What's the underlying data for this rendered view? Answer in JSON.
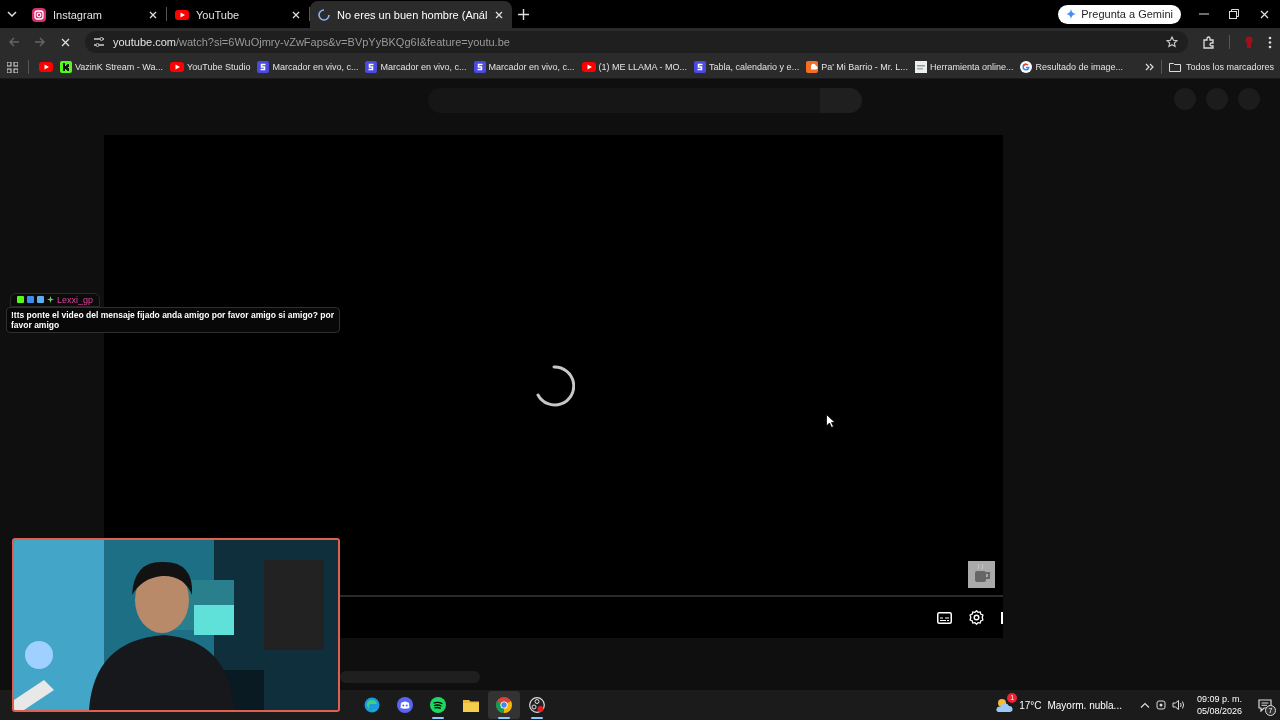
{
  "tabs": [
    {
      "title": "Instagram",
      "kind": "instagram",
      "selected": false
    },
    {
      "title": "YouTube",
      "kind": "youtube",
      "selected": false
    },
    {
      "title": "No eres un buen hombre (Anál",
      "kind": "loading",
      "selected": true
    }
  ],
  "gemini_button": "Pregunta a Gemini",
  "address": {
    "host": "youtube.com",
    "path": "/watch?si=6WuOjmry-vZwFaps&v=BVpYyBKQg6I&feature=youtu.be"
  },
  "bookmarks": [
    {
      "kind": "youtube"
    },
    {
      "label": "VazinK Stream - Wa...",
      "kind": "kick"
    },
    {
      "label": "YouTube Studio",
      "kind": "youtube"
    },
    {
      "label": "Marcador en vivo, c...",
      "kind": "scoreboard"
    },
    {
      "label": "Marcador en vivo, c...",
      "kind": "scoreboard"
    },
    {
      "label": "Marcador en vivo, c...",
      "kind": "scoreboard"
    },
    {
      "label": "(1) ME LLAMA - MO...",
      "kind": "youtube"
    },
    {
      "label": "Tabla, calendario y e...",
      "kind": "scoreboard"
    },
    {
      "label": "Pa' Mi Barrio - Mr. L...",
      "kind": "soundcloud"
    },
    {
      "label": "Herramienta online...",
      "kind": "page"
    },
    {
      "label": "Resultado de image...",
      "kind": "google"
    }
  ],
  "all_bookmarks": "Todos los marcadores",
  "chat": {
    "user": "Lexxi_gp",
    "message": "!tts ponte el video del mensaje fijado anda amigo por favor amigo si amigo? por favor amigo"
  },
  "taskbar": {
    "apps": [
      {
        "kind": "edge",
        "running": false,
        "selected": false
      },
      {
        "kind": "discord",
        "running": false,
        "selected": false
      },
      {
        "kind": "spotify",
        "running": true,
        "selected": false
      },
      {
        "kind": "files",
        "running": false,
        "selected": false
      },
      {
        "kind": "chrome",
        "running": true,
        "selected": true
      },
      {
        "kind": "obs",
        "running": true,
        "selected": false
      }
    ],
    "weather_badge": "1",
    "temperature": "17°C",
    "weather": "Mayorm. nubla...",
    "time": "09:09 p. m.",
    "date": "05/08/2026",
    "notifications": "7"
  }
}
